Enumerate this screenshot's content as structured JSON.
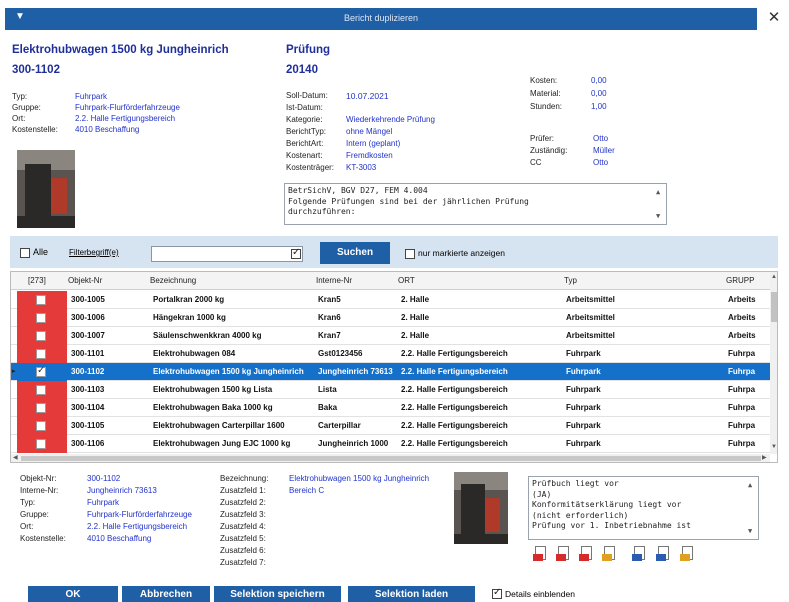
{
  "window": {
    "title": "Bericht duplizieren",
    "close_glyph": "✕",
    "menu_glyph": "▼"
  },
  "object": {
    "name": "Elektrohubwagen 1500 kg  Jungheinrich",
    "number": "300-1102",
    "labels": {
      "typ": "Typ:",
      "gruppe": "Gruppe:",
      "ort": "Ort:",
      "kostenstelle": "Kostenstelle:"
    },
    "values": {
      "typ": "Fuhrpark",
      "gruppe": "Fuhrpark-Flurförderfahrzeuge",
      "ort": "2.2. Halle Fertigungsbereich",
      "kostenstelle": "4010 Beschaffung"
    }
  },
  "report": {
    "name": "Prüfung",
    "number": "20140",
    "labels": {
      "soll": "Soll-Datum:",
      "ist": "Ist-Datum:",
      "kategorie": "Kategorie:",
      "typ": "BerichtTyp:",
      "art": "BerichtArt:",
      "kostenart": "Kostenart:",
      "kostentraeger": "Kostenträger:"
    },
    "values": {
      "soll": "10.07.2021",
      "ist": "",
      "kategorie": "Wiederkehrende Prüfung",
      "typ": "ohne Mängel",
      "art": "Intern (geplant)",
      "kostenart": "Fremdkosten",
      "kostentraeger": "KT-3003"
    },
    "costs_labels": {
      "kosten": "Kosten:",
      "material": "Material:",
      "stunden": "Stunden:"
    },
    "costs_values": {
      "kosten": "0,00",
      "material": "0,00",
      "stunden": "1,00"
    },
    "people_labels": {
      "pruefer": "Prüfer:",
      "zustaendig": "Zuständig:",
      "cc": "CC"
    },
    "people_values": {
      "pruefer": "Otto",
      "zustaendig": "Müller",
      "cc": "Otto"
    },
    "note_lines": [
      "BetrSichV, BGV D27, FEM 4.004",
      "Folgende Prüfungen sind bei der jährlichen Prüfung",
      "durchzuführen:"
    ]
  },
  "filter": {
    "all_label": "Alle",
    "filter_label": "Filterbegriff(e)",
    "search_value": "",
    "search_button": "Suchen",
    "marked_only_label": "nur markierte anzeigen"
  },
  "table": {
    "count": "[273]",
    "columns": [
      "Objekt-Nr",
      "Bezeichnung",
      "Interne-Nr",
      "ORT",
      "Typ",
      "GRUPP"
    ],
    "rows": [
      {
        "nr": "300-1005",
        "bez": "Portalkran 2000 kg",
        "intern": "Kran5",
        "ort": "2. Halle",
        "typ": "Arbeitsmittel",
        "gruppe": "Arbeits"
      },
      {
        "nr": "300-1006",
        "bez": "Hängekran 1000 kg",
        "intern": "Kran6",
        "ort": "2. Halle",
        "typ": "Arbeitsmittel",
        "gruppe": "Arbeits"
      },
      {
        "nr": "300-1007",
        "bez": "Säulenschwenkkran 4000 kg",
        "intern": "Kran7",
        "ort": "2. Halle",
        "typ": "Arbeitsmittel",
        "gruppe": "Arbeits"
      },
      {
        "nr": "300-1101",
        "bez": "Elektrohubwagen 084",
        "intern": "Gst0123456",
        "ort": "2.2. Halle Fertigungsbereich",
        "typ": "Fuhrpark",
        "gruppe": "Fuhrpa"
      },
      {
        "nr": "300-1102",
        "bez": "Elektrohubwagen 1500 kg  Jungheinrich",
        "intern": "Jungheinrich 73613",
        "ort": "2.2. Halle Fertigungsbereich",
        "typ": "Fuhrpark",
        "gruppe": "Fuhrpa"
      },
      {
        "nr": "300-1103",
        "bez": "Elektrohubwagen 1500 kg Lista",
        "intern": "Lista",
        "ort": "2.2. Halle Fertigungsbereich",
        "typ": "Fuhrpark",
        "gruppe": "Fuhrpa"
      },
      {
        "nr": "300-1104",
        "bez": "Elektrohubwagen Baka 1000 kg",
        "intern": "Baka",
        "ort": "2.2. Halle Fertigungsbereich",
        "typ": "Fuhrpark",
        "gruppe": "Fuhrpa"
      },
      {
        "nr": "300-1105",
        "bez": "Elektrohubwagen Carterpillar 1600",
        "intern": "Carterpillar",
        "ort": "2.2. Halle Fertigungsbereich",
        "typ": "Fuhrpark",
        "gruppe": "Fuhrpa"
      },
      {
        "nr": "300-1106",
        "bez": "Elektrohubwagen Jung EJC 1000 kg",
        "intern": "Jungheinrich 1000",
        "ort": "2.2. Halle Fertigungsbereich",
        "typ": "Fuhrpark",
        "gruppe": "Fuhrpa"
      }
    ],
    "selected_index": 4
  },
  "details": {
    "labels": {
      "nr": "Objekt-Nr:",
      "intern": "Interne-Nr:",
      "typ": "Typ:",
      "gruppe": "Gruppe:",
      "ort": "Ort:",
      "kostenstelle": "Kostenstelle:"
    },
    "values": {
      "nr": "300-1102",
      "intern": "Jungheinrich 73613",
      "typ": "Fuhrpark",
      "gruppe": "Fuhrpark-Flurförderfahrzeuge",
      "ort": "2.2. Halle Fertigungsbereich",
      "kostenstelle": "4010 Beschaffung"
    },
    "extra_labels": [
      "Bezeichnung:",
      "Zusatzfeld 1:",
      "Zusatzfeld 2:",
      "Zusatzfeld 3:",
      "Zusatzfeld 4:",
      "Zusatzfeld 5:",
      "Zusatzfeld 6:",
      "Zusatzfeld 7:"
    ],
    "extra_values": {
      "bezeichnung": "Elektrohubwagen 1500 kg  Jungheinrich",
      "zusatz1": "Bereich C"
    },
    "note_lines": [
      "Prüfbuch liegt vor",
      "(JA)",
      "Konformitätserklärung liegt vor",
      "(nicht erforderlich)",
      "Prüfung vor 1. Inbetriebnahme ist"
    ]
  },
  "footer": {
    "ok": "OK",
    "cancel": "Abbrechen",
    "save_selection": "Selektion speichern",
    "load_selection": "Selektion laden",
    "details_label": "Details einblenden"
  },
  "colors": {
    "accent": "#1f5fa6",
    "selection": "#1570c9",
    "marker_red": "#e43a3a",
    "link_blue": "#2233cc"
  }
}
